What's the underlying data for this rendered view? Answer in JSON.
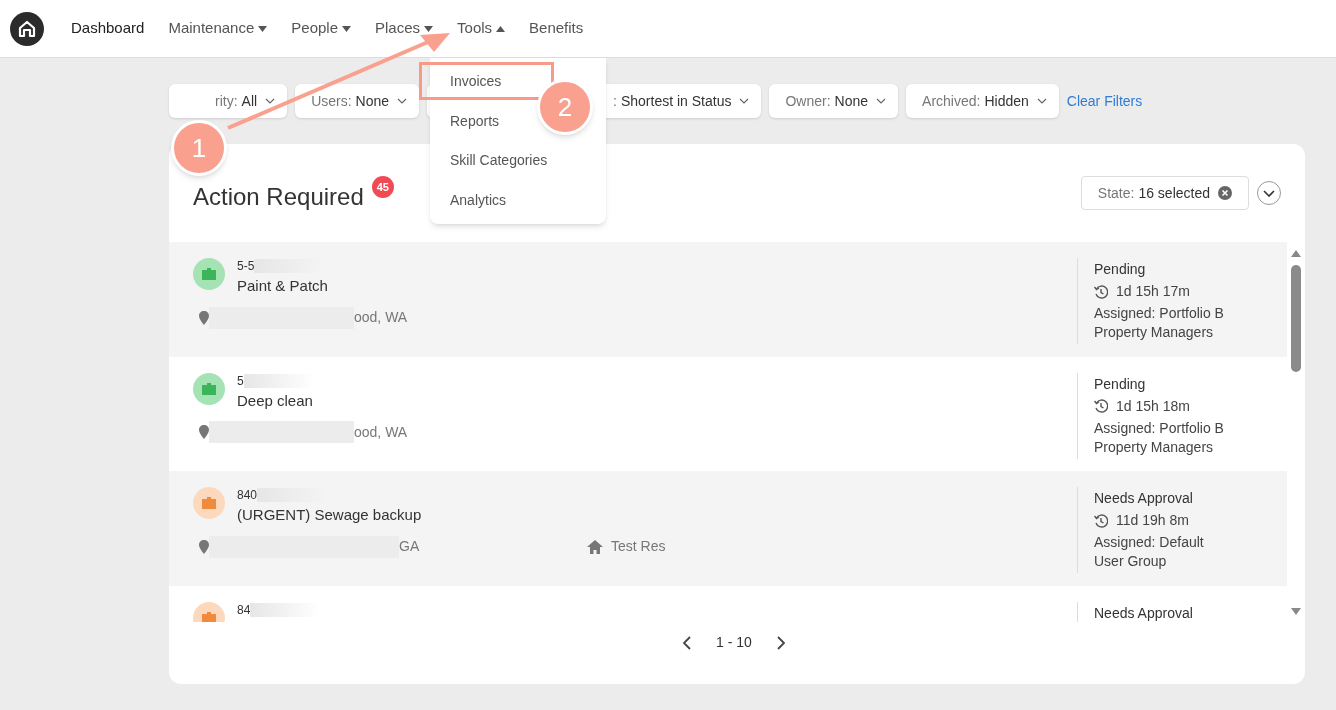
{
  "nav": {
    "items": [
      {
        "label": "Dashboard",
        "selected": true,
        "kind": "link"
      },
      {
        "label": "Maintenance",
        "selected": false,
        "kind": "menu",
        "expanded": false
      },
      {
        "label": "People",
        "selected": false,
        "kind": "menu",
        "expanded": false
      },
      {
        "label": "Places",
        "selected": false,
        "kind": "menu",
        "expanded": false
      },
      {
        "label": "Tools",
        "selected": false,
        "kind": "menu",
        "expanded": true
      },
      {
        "label": "Benefits",
        "selected": false,
        "kind": "link"
      }
    ],
    "menu": {
      "items": [
        {
          "label": "Invoices",
          "highlighted": true
        },
        {
          "label": "Reports",
          "highlighted": false
        },
        {
          "label": "Skill Categories",
          "highlighted": false
        },
        {
          "label": "Analytics",
          "highlighted": false
        }
      ]
    }
  },
  "filters": [
    {
      "label": "rity:",
      "value": "All",
      "covered": false
    },
    {
      "label": "Users:",
      "value": "None",
      "covered": false
    },
    {
      "label": ":",
      "value": "Shortest in Status",
      "covered": true
    },
    {
      "label": "Owner:",
      "value": "None",
      "covered": false
    },
    {
      "label": "Archived:",
      "value": "Hidden",
      "covered": false
    }
  ],
  "clear_filters": "Clear Filters",
  "panel": {
    "title": "Action Required",
    "count": "45",
    "state_filter": {
      "label": "State:",
      "value": "16 selected"
    },
    "rows": [
      {
        "id": "5-5",
        "title": "Paint & Patch",
        "address": "ood, WA",
        "status": "Pending",
        "duration": "1d 15h 17m",
        "assigned": "Assigned: Portfolio B Property Managers",
        "color": "#3cb55a"
      },
      {
        "id": "5",
        "title": "Deep clean",
        "address": "ood, WA",
        "status": "Pending",
        "duration": "1d 15h 18m",
        "assigned": "Assigned: Portfolio B Property Managers",
        "color": "#3cb55a"
      },
      {
        "id": "840",
        "title": "(URGENT) Sewage backup",
        "address": "GA",
        "property": "Test Res",
        "status": "Needs Approval",
        "duration": "11d 19h 8m",
        "assigned": "Assigned: Default User Group",
        "color": "#f08a3c"
      },
      {
        "id": "84",
        "status": "Needs Approval",
        "color": "#f08a3c"
      }
    ],
    "pagination": "1 - 10"
  },
  "callouts": [
    "1",
    "2"
  ]
}
